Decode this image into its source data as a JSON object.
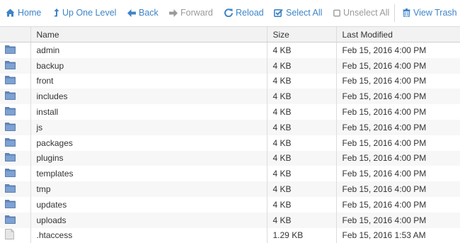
{
  "toolbar": {
    "home": "Home",
    "up": "Up One Level",
    "back": "Back",
    "forward": "Forward",
    "reload": "Reload",
    "select_all": "Select All",
    "unselect_all": "Unselect All",
    "view_trash": "View Trash"
  },
  "colors": {
    "accent": "#3f84c7",
    "disabled": "#9a9a9a",
    "folder": "#5f86bb"
  },
  "table": {
    "columns": [
      "Name",
      "Size",
      "Last Modified"
    ],
    "rows": [
      {
        "icon": "folder-icon",
        "name": "admin",
        "size": "4 KB",
        "modified": "Feb 15, 2016 4:00 PM"
      },
      {
        "icon": "folder-icon",
        "name": "backup",
        "size": "4 KB",
        "modified": "Feb 15, 2016 4:00 PM"
      },
      {
        "icon": "folder-icon",
        "name": "front",
        "size": "4 KB",
        "modified": "Feb 15, 2016 4:00 PM"
      },
      {
        "icon": "folder-icon",
        "name": "includes",
        "size": "4 KB",
        "modified": "Feb 15, 2016 4:00 PM"
      },
      {
        "icon": "folder-icon",
        "name": "install",
        "size": "4 KB",
        "modified": "Feb 15, 2016 4:00 PM"
      },
      {
        "icon": "folder-icon",
        "name": "js",
        "size": "4 KB",
        "modified": "Feb 15, 2016 4:00 PM"
      },
      {
        "icon": "folder-icon",
        "name": "packages",
        "size": "4 KB",
        "modified": "Feb 15, 2016 4:00 PM"
      },
      {
        "icon": "folder-icon",
        "name": "plugins",
        "size": "4 KB",
        "modified": "Feb 15, 2016 4:00 PM"
      },
      {
        "icon": "folder-icon",
        "name": "templates",
        "size": "4 KB",
        "modified": "Feb 15, 2016 4:00 PM"
      },
      {
        "icon": "folder-icon",
        "name": "tmp",
        "size": "4 KB",
        "modified": "Feb 15, 2016 4:00 PM"
      },
      {
        "icon": "folder-icon",
        "name": "updates",
        "size": "4 KB",
        "modified": "Feb 15, 2016 4:00 PM"
      },
      {
        "icon": "folder-icon",
        "name": "uploads",
        "size": "4 KB",
        "modified": "Feb 15, 2016 4:00 PM"
      },
      {
        "icon": "file-icon",
        "name": ".htaccess",
        "size": "1.29 KB",
        "modified": "Feb 15, 2016 1:53 AM"
      }
    ]
  }
}
